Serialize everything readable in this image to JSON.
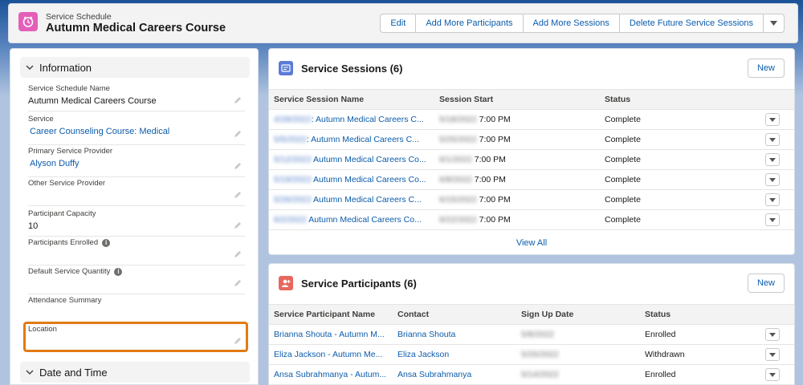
{
  "header": {
    "object_label": "Service Schedule",
    "record_title": "Autumn Medical Careers Course",
    "icon": "calendar-clock-icon",
    "icon_color": "#e35fb9",
    "actions": {
      "edit": "Edit",
      "add_participants": "Add More Participants",
      "add_sessions": "Add More Sessions",
      "delete_future": "Delete Future Service Sessions"
    }
  },
  "information": {
    "section_title": "Information",
    "fields": {
      "schedule_name": {
        "label": "Service Schedule Name",
        "value": "Autumn Medical Careers Course"
      },
      "service": {
        "label": "Service",
        "value": "Career Counseling Course: Medical"
      },
      "primary_provider": {
        "label": "Primary Service Provider",
        "value": "Alyson Duffy"
      },
      "other_provider": {
        "label": "Other Service Provider",
        "value": ""
      },
      "capacity": {
        "label": "Participant Capacity",
        "value": "10"
      },
      "enrolled": {
        "label": "Participants Enrolled",
        "value": ""
      },
      "default_qty": {
        "label": "Default Service Quantity",
        "value": ""
      },
      "attendance": {
        "label": "Attendance Summary",
        "value": ""
      },
      "location": {
        "label": "Location",
        "value": ""
      }
    }
  },
  "date_time": {
    "section_title": "Date and Time"
  },
  "sessions": {
    "title": "Service Sessions (6)",
    "new_label": "New",
    "icon_color": "#5a7bd6",
    "columns": [
      "Service Session Name",
      "Session Start",
      "Status"
    ],
    "rows": [
      {
        "prefix": "4/28/2022",
        "name": ": Autumn Medical Careers C...",
        "date": "5/18/2022",
        "time": "7:00 PM",
        "status": "Complete"
      },
      {
        "prefix": "5/5/2022",
        "name": ": Autumn Medical Careers C...",
        "date": "5/25/2022",
        "time": "7:00 PM",
        "status": "Complete"
      },
      {
        "prefix": "5/12/2022",
        "name": " Autumn Medical Careers Co...",
        "date": "6/1/2022",
        "time": "7:00 PM",
        "status": "Complete"
      },
      {
        "prefix": "5/19/2022",
        "name": " Autumn Medical Careers Co...",
        "date": "6/8/2022",
        "time": "7:00 PM",
        "status": "Complete"
      },
      {
        "prefix": "5/26/2022",
        "name": " Autumn Medical Careers C...",
        "date": "6/15/2022",
        "time": "7:00 PM",
        "status": "Complete"
      },
      {
        "prefix": "6/2/2022",
        "name": " Autumn Medical Careers Co...",
        "date": "6/22/2022",
        "time": "7:00 PM",
        "status": "Complete"
      }
    ],
    "view_all": "View All"
  },
  "participants": {
    "title": "Service Participants (6)",
    "new_label": "New",
    "icon_color": "#e8685d",
    "columns": [
      "Service Participant Name",
      "Contact",
      "Sign Up Date",
      "Status"
    ],
    "rows": [
      {
        "name": "Brianna Shouta - Autumn M...",
        "contact": "Brianna Shouta",
        "date": "5/8/2022",
        "status": "Enrolled"
      },
      {
        "name": "Eliza Jackson - Autumn Me...",
        "contact": "Eliza Jackson",
        "date": "5/25/2022",
        "status": "Withdrawn"
      },
      {
        "name": "Ansa Subrahmanya - Autum...",
        "contact": "Ansa Subrahmanya",
        "date": "5/14/2022",
        "status": "Enrolled"
      }
    ]
  }
}
